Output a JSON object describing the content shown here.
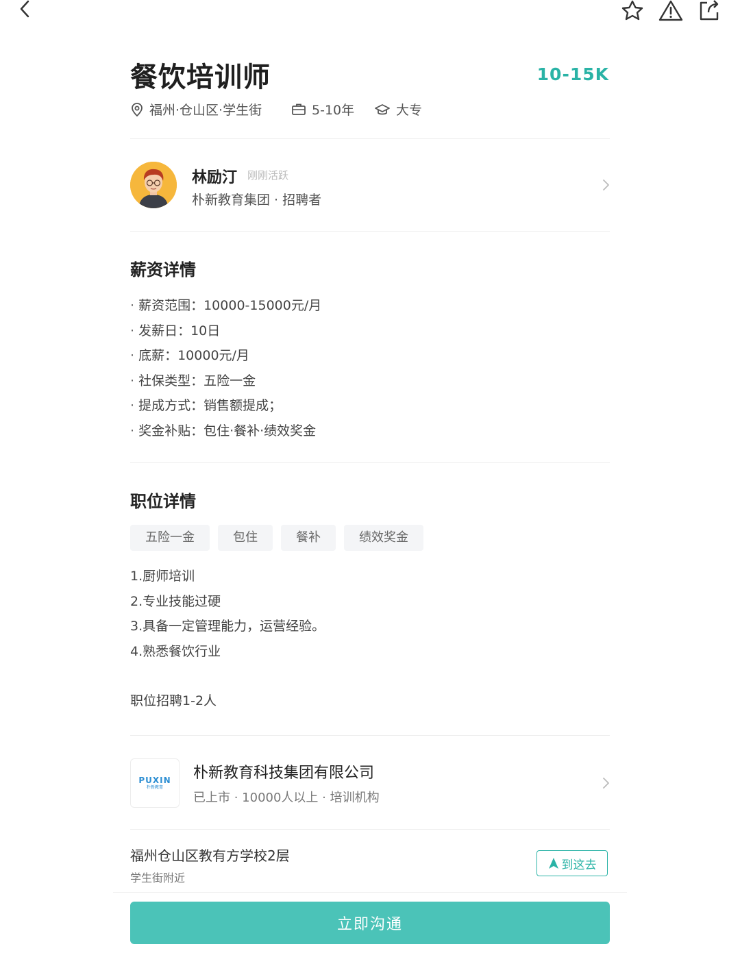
{
  "nav": {
    "back_icon": "chevron-left-icon",
    "favorite_icon": "star-icon",
    "report_icon": "warning-icon",
    "share_icon": "share-icon"
  },
  "job": {
    "title": "餐饮培训师",
    "salary": "10-15K",
    "location": "福州·仓山区·学生街",
    "experience": "5-10年",
    "education": "大专"
  },
  "recruiter": {
    "name": "林励汀",
    "active": "刚刚活跃",
    "subtitle": "朴新教育集团 · 招聘者"
  },
  "salary_details": {
    "title": "薪资详情",
    "items": [
      "薪资范围：10000-15000元/月",
      "发薪日：10日",
      "底薪：10000元/月",
      "社保类型：五险一金",
      "提成方式：销售额提成；",
      "奖金补贴：包住·餐补·绩效奖金"
    ]
  },
  "job_details": {
    "title": "职位详情",
    "tags": [
      "五险一金",
      "包住",
      "餐补",
      "绩效奖金"
    ],
    "requirements": [
      "1.厨师培训",
      "2.专业技能过硬",
      "3.具备一定管理能力，运营经验。",
      "4.熟悉餐饮行业"
    ],
    "recruit_count": "职位招聘1-2人"
  },
  "company": {
    "name": "朴新教育科技集团有限公司",
    "subtitle": "已上市 · 10000人以上 · 培训机构",
    "logo_text": "PUXIN",
    "logo_sub": "朴新教育"
  },
  "address": {
    "line1": "福州仓山区教有方学校2层",
    "line2": "学生街附近",
    "goto_label": "到这去"
  },
  "cta": {
    "label": "立即沟通"
  },
  "colors": {
    "accent": "#2ab3a6",
    "cta": "#4bc3b8"
  }
}
